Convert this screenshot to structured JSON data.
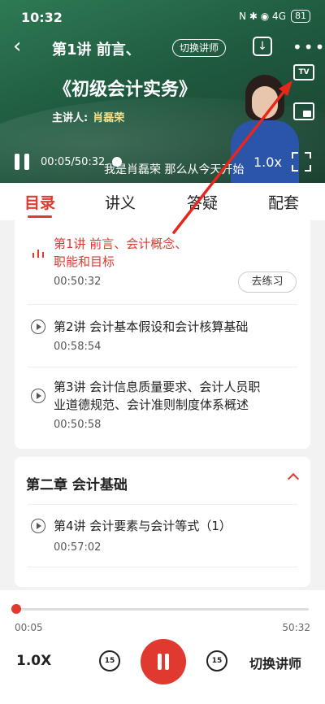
{
  "status_bar": {
    "time": "10:32",
    "icons_text": "N ✱ ◉ 4G",
    "battery": "81"
  },
  "video": {
    "lesson_title": "第1讲 前言、",
    "switch_lecturer_label": "切换讲师",
    "book_title": "《初级会计实务》",
    "lecturer_label": "主讲人:",
    "lecturer_name": "肖磊荣",
    "time_readout": "00:05/50:32",
    "subtitle": "我是肖磊荣 那么从今天开始",
    "speed": "1.0x",
    "tv_label": "TV"
  },
  "tabs": [
    {
      "label": "目录"
    },
    {
      "label": "讲义"
    },
    {
      "label": "答疑"
    },
    {
      "label": "配套"
    }
  ],
  "lessons": [
    {
      "title_line1": "第1讲 前言、会计概念、",
      "title_line2": "职能和目标",
      "duration": "00:50:32",
      "action": "去练习"
    },
    {
      "title_line1": "第2讲 会计基本假设和会计核算基础",
      "duration": "00:58:54"
    },
    {
      "title_line1": "第3讲 会计信息质量要求、会计人员职",
      "title_line2": "业道德规范、会计准则制度体系概述",
      "duration": "00:50:58"
    }
  ],
  "chapter2": {
    "title": "第二章 会计基础",
    "lessons": [
      {
        "title_line1": "第4讲 会计要素与会计等式（1）",
        "duration": "00:57:02"
      }
    ]
  },
  "player": {
    "current": "00:05",
    "total": "50:32",
    "progress_fraction": 0.002,
    "speed": "1.0X",
    "skip_back": "15",
    "skip_forward": "15",
    "switch_lecturer": "切换讲师"
  },
  "colors": {
    "accent": "#e03a30",
    "video_bg": "#1f5a3f"
  }
}
